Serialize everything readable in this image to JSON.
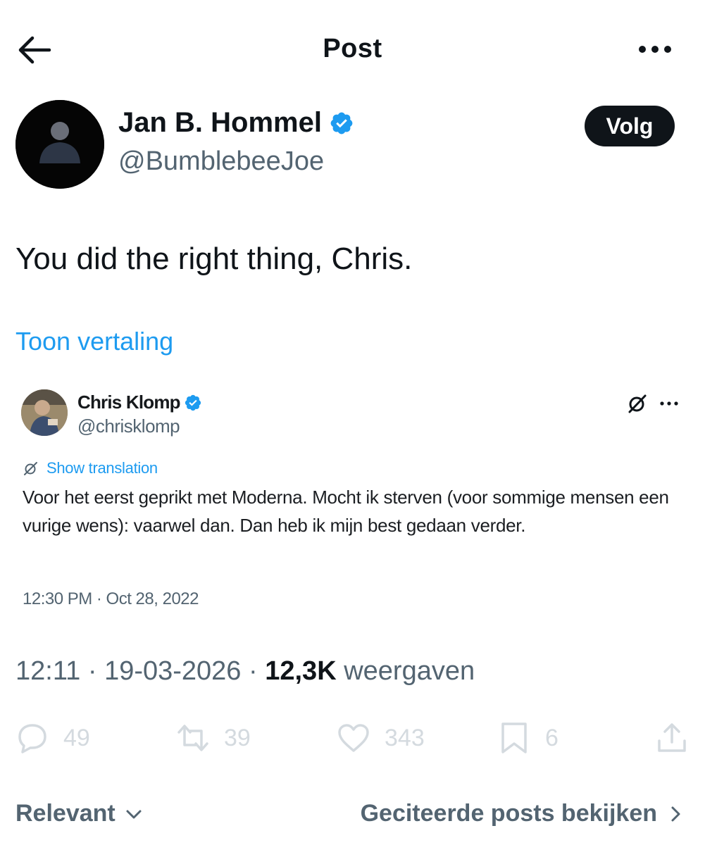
{
  "header": {
    "title": "Post",
    "back_icon": "arrow-left-icon",
    "more_icon": "more-horizontal-icon"
  },
  "author": {
    "name": "Jan B. Hommel",
    "handle": "@BumblebeeJoe",
    "verified": true,
    "follow_label": "Volg"
  },
  "post": {
    "text": "You did the right thing, Chris.",
    "translate_label": "Toon vertaling"
  },
  "quoted": {
    "name": "Chris Klomp",
    "handle": "@chrisklomp",
    "verified": true,
    "translate_label": "Show translation",
    "text": "Voor het eerst geprikt met Moderna. Mocht ik sterven (voor sommige mensen een vurige wens): vaarwel dan. Dan heb ik mijn best gedaan verder.",
    "timestamp": "12:30 PM · Oct 28, 2022"
  },
  "meta": {
    "time": "12:11",
    "separator": "·",
    "date": "19-03-2026",
    "views_count": "12,3K",
    "views_label": "weergaven"
  },
  "actions": {
    "replies": "49",
    "reposts": "39",
    "likes": "343",
    "bookmarks": "6"
  },
  "footer": {
    "sort_label": "Relevant",
    "quotes_link": "Geciteerde posts bekijken"
  },
  "colors": {
    "accent": "#1d9bf0",
    "text": "#0f1419",
    "secondary": "#536471",
    "verified": "#1d9bf0"
  }
}
